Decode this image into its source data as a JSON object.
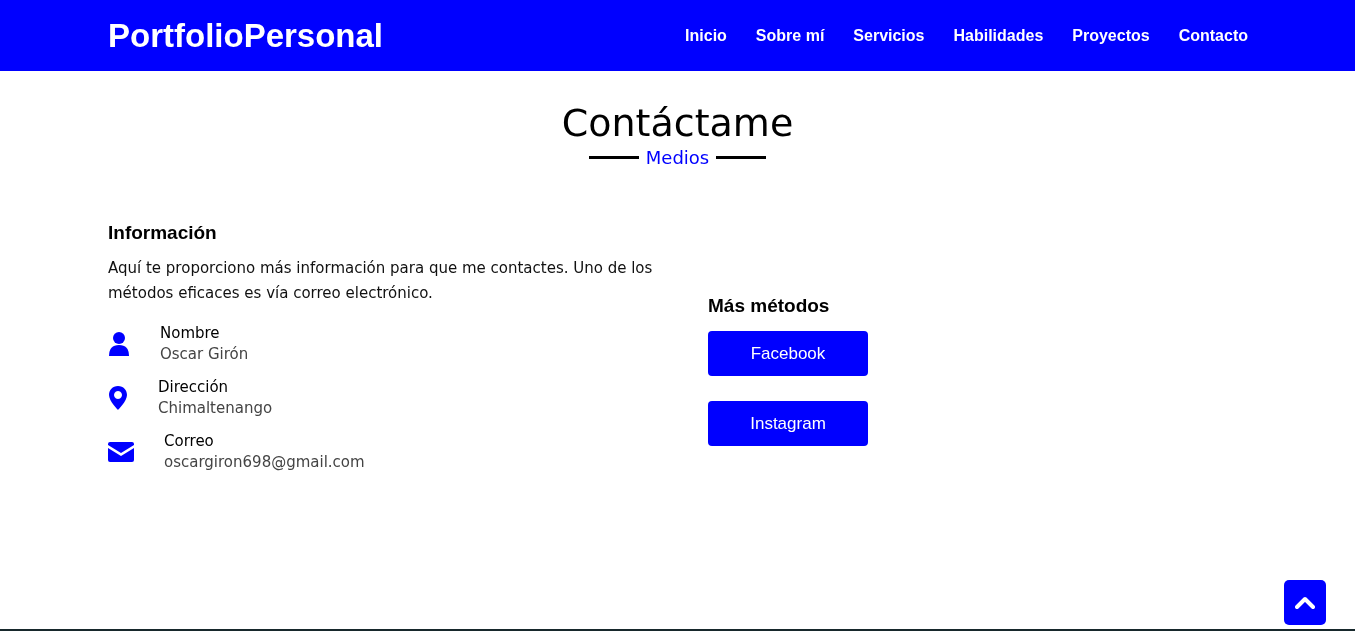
{
  "header": {
    "logo": "PortfolioPersonal",
    "nav": [
      {
        "label": "Inicio"
      },
      {
        "label": "Sobre mí"
      },
      {
        "label": "Servicios"
      },
      {
        "label": "Habilidades"
      },
      {
        "label": "Proyectos"
      },
      {
        "label": "Contacto"
      }
    ]
  },
  "section": {
    "title": "Contáctame",
    "subtitle": "Medios"
  },
  "info": {
    "heading": "Información",
    "text": "Aquí te proporciono más información para que me contactes. Uno de los métodos eficaces es vía correo electrónico.",
    "items": [
      {
        "kind": "person",
        "label": "Nombre",
        "value": "Oscar Girón"
      },
      {
        "kind": "location",
        "label": "Dirección",
        "value": "Chimaltenango"
      },
      {
        "kind": "mail",
        "label": "Correo",
        "value": "oscargiron698@gmail.com"
      }
    ]
  },
  "more": {
    "heading": "Más métodos",
    "buttons": [
      "Facebook",
      "Instagram"
    ]
  }
}
